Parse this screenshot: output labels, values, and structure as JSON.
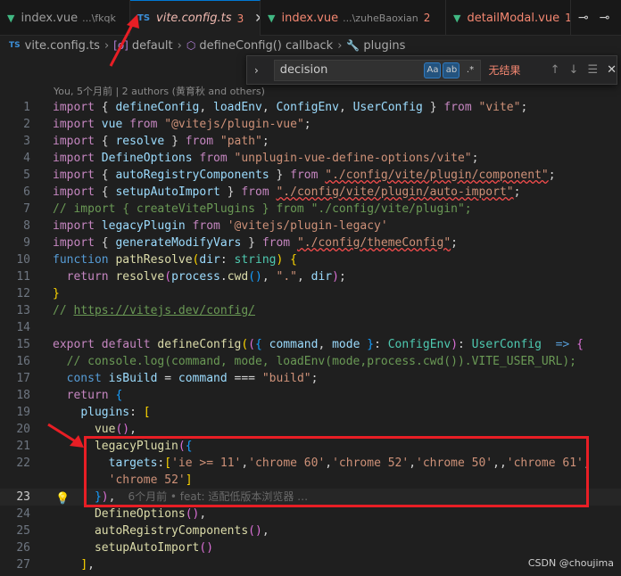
{
  "tabs": [
    {
      "label": "index.vue",
      "desc": "...\\fkqk",
      "type": "vue",
      "active": false
    },
    {
      "label": "vite.config.ts",
      "count": "3",
      "type": "ts",
      "active": true
    },
    {
      "label": "index.vue",
      "desc": "...\\zuheBaoxian",
      "count": "2",
      "type": "vue",
      "active": false
    },
    {
      "label": "detailModal.vue",
      "count": "1",
      "type": "vue",
      "active": false
    }
  ],
  "breadcrumb": {
    "file": "vite.config.ts",
    "file_icon": "TS",
    "items": [
      "default",
      "defineConfig() callback",
      "plugins"
    ]
  },
  "find": {
    "query": "decision",
    "match_case": "Aa",
    "whole_word": "ab",
    "regex": ".*",
    "result": "无结果"
  },
  "blame_header": "You, 5个月前 | 2 authors (黄育秋 and others)",
  "inline_blame": "6个月前 • feat: 适配低版本浏览器 …",
  "watermark": "CSDN @choujima",
  "lines": [
    {
      "n": "1",
      "t": [
        [
          "kc",
          "import "
        ],
        [
          "pl",
          "{ "
        ],
        [
          "id",
          "defineConfig"
        ],
        [
          "pl",
          ", "
        ],
        [
          "id",
          "loadEnv"
        ],
        [
          "pl",
          ", "
        ],
        [
          "id",
          "ConfigEnv"
        ],
        [
          "pl",
          ", "
        ],
        [
          "id",
          "UserConfig"
        ],
        [
          "pl",
          " } "
        ],
        [
          "kc",
          "from "
        ],
        [
          "str",
          "\"vite\""
        ],
        [
          "pl",
          ";"
        ]
      ]
    },
    {
      "n": "2",
      "t": [
        [
          "kc",
          "import "
        ],
        [
          "id",
          "vue "
        ],
        [
          "kc",
          "from "
        ],
        [
          "str",
          "\"@vitejs/plugin-vue\""
        ],
        [
          "pl",
          ";"
        ]
      ]
    },
    {
      "n": "3",
      "t": [
        [
          "kc",
          "import "
        ],
        [
          "pl",
          "{ "
        ],
        [
          "id",
          "resolve"
        ],
        [
          "pl",
          " } "
        ],
        [
          "kc",
          "from "
        ],
        [
          "str",
          "\"path\""
        ],
        [
          "pl",
          ";"
        ]
      ]
    },
    {
      "n": "4",
      "t": [
        [
          "kc",
          "import "
        ],
        [
          "id",
          "DefineOptions "
        ],
        [
          "kc",
          "from "
        ],
        [
          "str",
          "\"unplugin-vue-define-options/vite\""
        ],
        [
          "pl",
          ";"
        ]
      ]
    },
    {
      "n": "5",
      "t": [
        [
          "kc",
          "import "
        ],
        [
          "pl",
          "{ "
        ],
        [
          "id",
          "autoRegistryComponents"
        ],
        [
          "pl",
          " } "
        ],
        [
          "kc",
          "from "
        ],
        [
          "str sq",
          "\"./config/vite/plugin/component\""
        ],
        [
          "pl",
          ";"
        ]
      ]
    },
    {
      "n": "6",
      "t": [
        [
          "kc",
          "import "
        ],
        [
          "pl",
          "{ "
        ],
        [
          "id",
          "setupAutoImport"
        ],
        [
          "pl",
          " } "
        ],
        [
          "kc",
          "from "
        ],
        [
          "str sq",
          "\"./config/vite/plugin/auto-import\""
        ],
        [
          "pl",
          ";"
        ]
      ]
    },
    {
      "n": "7",
      "t": [
        [
          "cm",
          "// import { createVitePlugins } from \"./config/vite/plugin\";"
        ]
      ]
    },
    {
      "n": "8",
      "t": [
        [
          "kc",
          "import "
        ],
        [
          "id",
          "legacyPlugin "
        ],
        [
          "kc",
          "from "
        ],
        [
          "str",
          "'@vitejs/plugin-legacy'"
        ]
      ]
    },
    {
      "n": "9",
      "t": [
        [
          "kc",
          "import "
        ],
        [
          "pl",
          "{ "
        ],
        [
          "id",
          "generateModifyVars"
        ],
        [
          "pl",
          " } "
        ],
        [
          "kc",
          "from "
        ],
        [
          "str sq",
          "\"./config/themeConfig\""
        ],
        [
          "pl",
          ";"
        ]
      ]
    },
    {
      "n": "10",
      "t": [
        [
          "kw",
          "function "
        ],
        [
          "fn",
          "pathResolve"
        ],
        [
          "br1",
          "("
        ],
        [
          "id",
          "dir"
        ],
        [
          "pl",
          ": "
        ],
        [
          "ty",
          "string"
        ],
        [
          "br1",
          ")"
        ],
        [
          "pl",
          " "
        ],
        [
          "br1",
          "{"
        ]
      ]
    },
    {
      "n": "11",
      "t": [
        [
          "pl",
          "  "
        ],
        [
          "kc",
          "return "
        ],
        [
          "fn",
          "resolve"
        ],
        [
          "br2",
          "("
        ],
        [
          "id",
          "process"
        ],
        [
          "pl",
          "."
        ],
        [
          "fn",
          "cwd"
        ],
        [
          "br3",
          "()"
        ],
        [
          "pl",
          ", "
        ],
        [
          "str",
          "\".\""
        ],
        [
          "pl",
          ", "
        ],
        [
          "id",
          "dir"
        ],
        [
          "br2",
          ")"
        ],
        [
          "pl",
          ";"
        ]
      ]
    },
    {
      "n": "12",
      "t": [
        [
          "br1",
          "}"
        ]
      ]
    },
    {
      "n": "13",
      "t": [
        [
          "cm",
          "// "
        ],
        [
          "cm lnk",
          "https://vitejs.dev/config/"
        ]
      ]
    },
    {
      "n": "14",
      "t": []
    },
    {
      "n": "15",
      "t": [
        [
          "kc",
          "export "
        ],
        [
          "kc",
          "default "
        ],
        [
          "fn",
          "defineConfig"
        ],
        [
          "br1",
          "("
        ],
        [
          "br2",
          "("
        ],
        [
          "br3",
          "{ "
        ],
        [
          "id",
          "command"
        ],
        [
          "pl",
          ", "
        ],
        [
          "id",
          "mode "
        ],
        [
          "br3",
          "}"
        ],
        [
          "pl",
          ": "
        ],
        [
          "ty",
          "ConfigEnv"
        ],
        [
          "br2",
          ")"
        ],
        [
          "pl",
          ": "
        ],
        [
          "ty",
          "UserConfig "
        ],
        [
          "pl",
          " "
        ],
        [
          "kw",
          "=> "
        ],
        [
          "br2",
          "{"
        ]
      ]
    },
    {
      "n": "16",
      "t": [
        [
          "pl",
          "  "
        ],
        [
          "cm",
          "// console.log(command, mode, loadEnv(mode,process.cwd()).VITE_USER_URL);"
        ]
      ]
    },
    {
      "n": "17",
      "t": [
        [
          "pl",
          "  "
        ],
        [
          "kw",
          "const "
        ],
        [
          "id",
          "isBuild"
        ],
        [
          "pl",
          " = "
        ],
        [
          "id",
          "command"
        ],
        [
          "pl",
          " === "
        ],
        [
          "str",
          "\"build\""
        ],
        [
          "pl",
          ";"
        ]
      ]
    },
    {
      "n": "18",
      "t": [
        [
          "pl",
          "  "
        ],
        [
          "kc",
          "return "
        ],
        [
          "br3",
          "{"
        ]
      ]
    },
    {
      "n": "19",
      "t": [
        [
          "pl",
          "    "
        ],
        [
          "id",
          "plugins"
        ],
        [
          "pl",
          ": "
        ],
        [
          "br1",
          "["
        ]
      ]
    },
    {
      "n": "20",
      "t": [
        [
          "pl",
          "      "
        ],
        [
          "fn",
          "vue"
        ],
        [
          "br2",
          "()"
        ],
        [
          "pl",
          ","
        ]
      ]
    },
    {
      "n": "21",
      "t": [
        [
          "pl",
          "      "
        ],
        [
          "fn",
          "legacyPlugin"
        ],
        [
          "br2",
          "("
        ],
        [
          "br3",
          "{"
        ]
      ]
    },
    {
      "n": "22",
      "t": [
        [
          "pl",
          "        "
        ],
        [
          "id",
          "targets"
        ],
        [
          "pl",
          ":"
        ],
        [
          "br1",
          "["
        ],
        [
          "str",
          "'ie >= 11'"
        ],
        [
          "pl",
          ","
        ],
        [
          "str",
          "'chrome 60'"
        ],
        [
          "pl",
          ","
        ],
        [
          "str",
          "'chrome 52'"
        ],
        [
          "pl",
          ","
        ],
        [
          "str",
          "'chrome 50'"
        ],
        [
          "pl",
          ",,"
        ],
        [
          "str",
          "'chrome 61'"
        ],
        [
          "pl",
          ","
        ]
      ]
    },
    {
      "n": "",
      "t": [
        [
          "pl",
          "        "
        ],
        [
          "str",
          "'chrome 52'"
        ],
        [
          "br1",
          "]"
        ]
      ]
    },
    {
      "n": "23",
      "cur": true,
      "t": [
        [
          "pl",
          "      "
        ],
        [
          "br3",
          "}"
        ],
        [
          "br2",
          ")"
        ],
        [
          "pl",
          ","
        ]
      ]
    },
    {
      "n": "24",
      "t": [
        [
          "pl",
          "      "
        ],
        [
          "fn",
          "DefineOptions"
        ],
        [
          "br2",
          "()"
        ],
        [
          "pl",
          ","
        ]
      ]
    },
    {
      "n": "25",
      "t": [
        [
          "pl",
          "      "
        ],
        [
          "fn",
          "autoRegistryComponents"
        ],
        [
          "br2",
          "()"
        ],
        [
          "pl",
          ","
        ]
      ]
    },
    {
      "n": "26",
      "t": [
        [
          "pl",
          "      "
        ],
        [
          "fn",
          "setupAutoImport"
        ],
        [
          "br2",
          "()"
        ]
      ]
    },
    {
      "n": "27",
      "t": [
        [
          "pl",
          "    "
        ],
        [
          "br1",
          "]"
        ],
        [
          "pl",
          ","
        ]
      ]
    }
  ]
}
